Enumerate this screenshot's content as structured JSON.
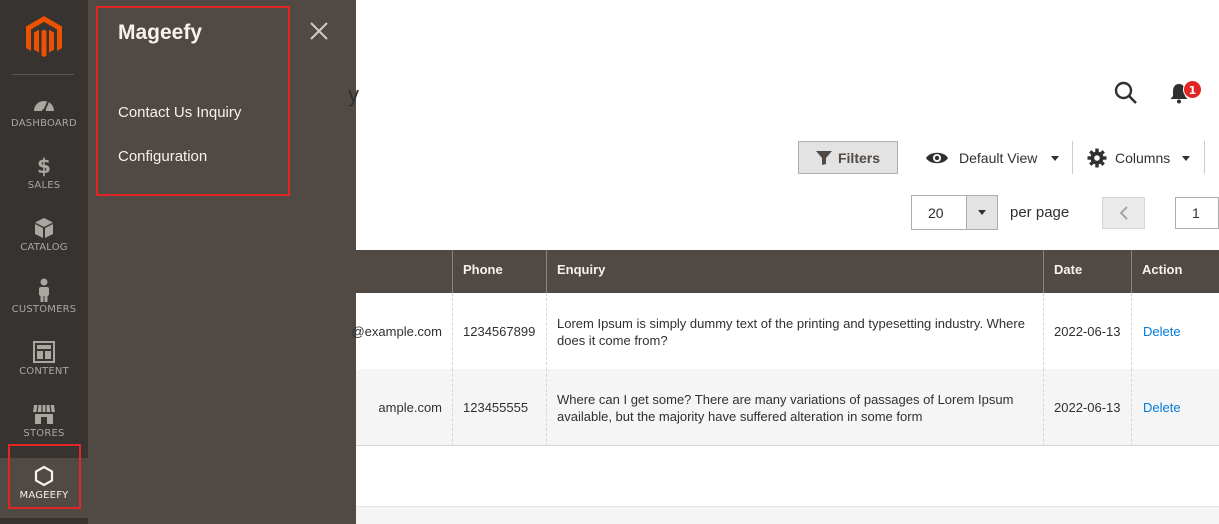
{
  "nav": {
    "items": [
      {
        "label": "DASHBOARD",
        "icon": "dashboard-icon"
      },
      {
        "label": "SALES",
        "icon": "dollar-icon"
      },
      {
        "label": "CATALOG",
        "icon": "box-icon"
      },
      {
        "label": "CUSTOMERS",
        "icon": "person-icon"
      },
      {
        "label": "CONTENT",
        "icon": "layout-icon"
      },
      {
        "label": "STORES",
        "icon": "store-icon"
      },
      {
        "label": "MAGEEFY",
        "icon": "hexagon-icon"
      }
    ]
  },
  "panel": {
    "title": "Mageefy",
    "links": [
      "Contact Us Inquiry",
      "Configuration"
    ]
  },
  "header": {
    "title_fragment": "y",
    "notification_count": "1"
  },
  "toolbar": {
    "filters_label": "Filters",
    "view_label": "Default View",
    "columns_label": "Columns"
  },
  "pager": {
    "per_page_value": "20",
    "per_page_label": "per page",
    "page_value": "1"
  },
  "grid": {
    "columns": [
      "Phone",
      "Enquiry",
      "Date",
      "Action"
    ],
    "rows": [
      {
        "email": "@example.com",
        "phone": "1234567899",
        "enquiry": "Lorem Ipsum is simply dummy text of the printing and typesetting industry. Where does it come from?",
        "date": "2022-06-13",
        "action": "Delete"
      },
      {
        "email": "ample.com",
        "phone": "123455555",
        "enquiry": "Where can I get some? There are many variations of passages of Lorem Ipsum available, but the majority have suffered alteration in some form",
        "date": "2022-06-13",
        "action": "Delete"
      }
    ]
  },
  "colors": {
    "nav_bg": "#373330",
    "panel_bg": "#514943",
    "highlight": "#e22626",
    "brand": "#eb5202",
    "link": "#007bdb"
  }
}
